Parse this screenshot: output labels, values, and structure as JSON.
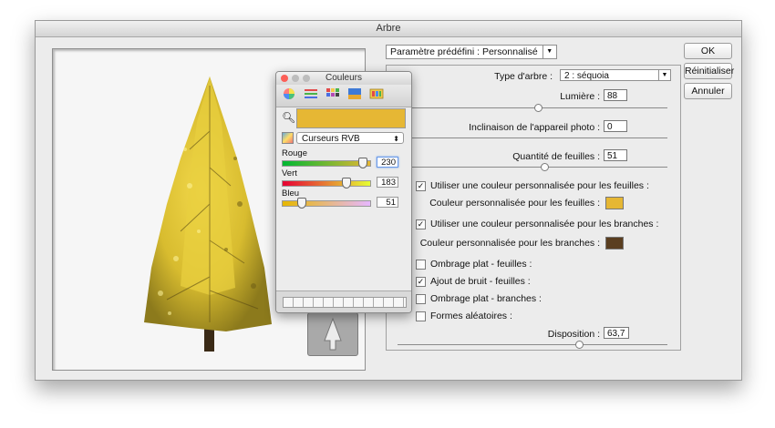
{
  "window": {
    "title": "Arbre"
  },
  "buttons": {
    "ok": "OK",
    "reset": "Réinitialiser",
    "cancel": "Annuler"
  },
  "preset": {
    "label": "Paramètre prédéfini : Personnalisé"
  },
  "params": {
    "tree_type_label": "Type d'arbre :",
    "tree_type_value": "2 : séquoia",
    "light_label": "Lumière :",
    "light_value": "88",
    "camera_tilt_label": "Inclinaison de l'appareil photo :",
    "camera_tilt_value": "0",
    "leaf_amount_label": "Quantité de feuilles :",
    "leaf_amount_value": "51",
    "use_leaf_color_label": "Utiliser une couleur personnalisée pour les feuilles :",
    "use_leaf_color_checked": true,
    "leaf_color_label": "Couleur personnalisée pour les feuilles :",
    "leaf_color": "#e6b734",
    "use_branch_color_label": "Utiliser une couleur personnalisée pour les branches :",
    "use_branch_color_checked": true,
    "branch_color_label": "Couleur personnalisée pour les branches :",
    "branch_color": "#5a3e20",
    "flat_shading_leaves_label": "Ombrage plat - feuilles :",
    "flat_shading_leaves_checked": false,
    "noise_leaves_label": "Ajout de bruit - feuilles :",
    "noise_leaves_checked": true,
    "flat_shading_branches_label": "Ombrage plat - branches :",
    "flat_shading_branches_checked": false,
    "random_shapes_label": "Formes aléatoires :",
    "random_shapes_checked": false,
    "arrangement_label": "Disposition :",
    "arrangement_value": "63,7"
  },
  "palette": {
    "title": "Couleurs",
    "mode": "Curseurs RVB",
    "current_color": "#e6b734",
    "red_label": "Rouge",
    "red_value": "230",
    "green_label": "Vert",
    "green_value": "183",
    "blue_label": "Bleu",
    "blue_value": "51"
  }
}
